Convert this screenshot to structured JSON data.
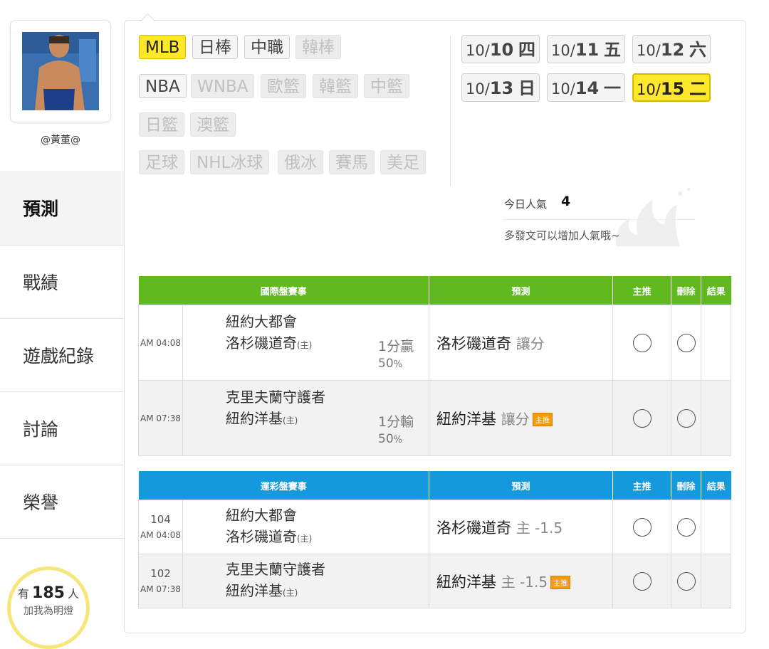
{
  "user": {
    "name": "@黃董@"
  },
  "sidebar": {
    "items": [
      {
        "label": "預測"
      },
      {
        "label": "戰績"
      },
      {
        "label": "遊戲紀錄"
      },
      {
        "label": "討論"
      },
      {
        "label": "榮譽"
      }
    ]
  },
  "fans": {
    "prefix": "有",
    "count": "185",
    "suffix": "人",
    "note": "加我為明燈"
  },
  "sports": [
    {
      "label": "MLB",
      "state": "selected"
    },
    {
      "label": "日棒",
      "state": "on"
    },
    {
      "label": "中職",
      "state": "on"
    },
    {
      "label": "韓棒",
      "state": "dim"
    },
    {
      "label": "NBA",
      "state": "on"
    },
    {
      "label": "WNBA",
      "state": "dim"
    },
    {
      "label": "歐籃",
      "state": "dim"
    },
    {
      "label": "韓籃",
      "state": "dim"
    },
    {
      "label": "中籃",
      "state": "dim"
    },
    {
      "label": "日籃",
      "state": "dim"
    },
    {
      "label": "澳籃",
      "state": "dim"
    },
    {
      "label": "足球",
      "state": "dim"
    },
    {
      "label": "NHL冰球",
      "state": "dim"
    },
    {
      "label": "俄冰",
      "state": "dim"
    },
    {
      "label": "賽馬",
      "state": "dim"
    },
    {
      "label": "美足",
      "state": "dim"
    }
  ],
  "dates": [
    {
      "md": "10/",
      "day": "10",
      "wd": "四"
    },
    {
      "md": "10/",
      "day": "11",
      "wd": "五"
    },
    {
      "md": "10/",
      "day": "12",
      "wd": "六"
    },
    {
      "md": "10/",
      "day": "13",
      "wd": "日"
    },
    {
      "md": "10/",
      "day": "14",
      "wd": "一"
    },
    {
      "md": "10/",
      "day": "15",
      "wd": "二",
      "selected": true
    }
  ],
  "popularity": {
    "label": "今日人氣",
    "value": "4",
    "note": "多發文可以增加人氣哦~"
  },
  "international": {
    "headers": {
      "match": "國際盤賽事",
      "prediction": "預測",
      "main_pick": "主推",
      "delete": "刪除",
      "result": "結果"
    },
    "rows": [
      {
        "time": "AM 04:08",
        "away": "紐約大都會",
        "home": "洛杉磯道奇",
        "host_mark": "(主)",
        "line": "1分贏",
        "pct": "50",
        "pct_unit": "%",
        "pick": "洛杉磯道奇",
        "pick_type": "讓分",
        "main_badge": ""
      },
      {
        "time": "AM 07:38",
        "away": "克里夫蘭守護者",
        "home": "紐約洋基",
        "host_mark": "(主)",
        "line": "1分輸",
        "pct": "50",
        "pct_unit": "%",
        "pick": "紐約洋基",
        "pick_type": "讓分",
        "main_badge": "主推"
      }
    ]
  },
  "sportslottery": {
    "headers": {
      "match": "運彩盤賽事",
      "prediction": "預測",
      "main_pick": "主推",
      "delete": "刪除",
      "result": "結果"
    },
    "rows": [
      {
        "num": "104",
        "time": "AM 04:08",
        "away": "紐約大都會",
        "home": "洛杉磯道奇",
        "host_mark": "(主)",
        "pick": "洛杉磯道奇",
        "pick_type": "主 -1.5",
        "main_badge": ""
      },
      {
        "num": "102",
        "time": "AM 07:38",
        "away": "克里夫蘭守護者",
        "home": "紐約洋基",
        "host_mark": "(主)",
        "pick": "紐約洋基",
        "pick_type": "主 -1.5",
        "main_badge": "主推"
      }
    ]
  },
  "colors": {
    "selected": "#ffe72a",
    "intl_header": "#5fb91f",
    "lottery_header": "#1599dd",
    "badge": "#f39c12"
  }
}
